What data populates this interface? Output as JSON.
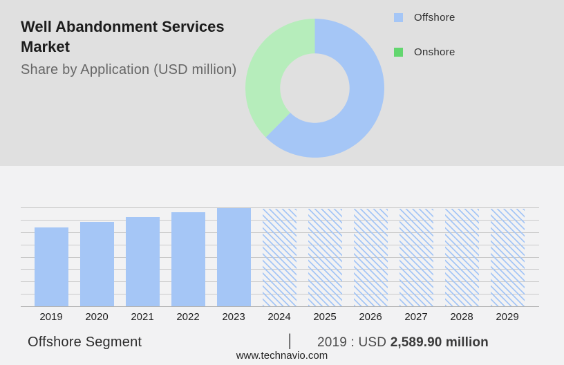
{
  "colors": {
    "top_bg": "#e0e0e0",
    "bottom_bg": "#f2f2f3",
    "bar_blue": "#a5c6f6",
    "donut_green": "#b6edbb",
    "legend_green": "#63d66f",
    "gridline": "#c9c9c9",
    "axis_line": "#b3b3b3",
    "title_text": "#1c1c1c",
    "subtitle_text": "#666666",
    "body_text": "#2e2e2e"
  },
  "header": {
    "title_line1": "Well Abandonment Services",
    "title_line2": "Market",
    "title_full": "Well Abandonment Services Market",
    "subtitle": "Share by Application (USD million)"
  },
  "legend": {
    "items": [
      {
        "label": "Offshore",
        "color_key": "bar_blue"
      },
      {
        "label": "Onshore",
        "color_key": "legend_green"
      }
    ]
  },
  "chart_data": [
    {
      "type": "pie",
      "variant": "donut",
      "title": "Share by Application (USD million)",
      "labels": [
        "Offshore",
        "Onshore"
      ],
      "values_pct": [
        62.5,
        37.5
      ],
      "colors": [
        "#a5c6f6",
        "#b6edbb"
      ],
      "legend_position": "right",
      "start_angle_deg_from_top": 0,
      "direction": "clockwise",
      "inner_radius_ratio": 0.5
    },
    {
      "type": "bar",
      "title": "Offshore Segment market size by year (USD million)",
      "categories": [
        "2019",
        "2020",
        "2021",
        "2022",
        "2023",
        "2024",
        "2025",
        "2026",
        "2027",
        "2028",
        "2029"
      ],
      "values_relative": [
        0.8,
        0.86,
        0.91,
        0.955,
        1.0,
        0.99,
        0.99,
        0.99,
        0.99,
        0.99,
        0.99
      ],
      "bar_styles": [
        "solid",
        "solid",
        "solid",
        "solid",
        "solid",
        "hatched",
        "hatched",
        "hatched",
        "hatched",
        "hatched",
        "hatched"
      ],
      "hatched_bars_meaning": "forecast years",
      "labeled_point": {
        "year": "2019",
        "value": "USD 2,589.90 million"
      },
      "value_2019_usd_million": 2589.9,
      "xlabel": "",
      "ylabel": "",
      "y_axis_labels_shown": false,
      "grid": true,
      "gridline_count": 9
    }
  ],
  "donut": {
    "segments": [
      {
        "name": "Offshore",
        "pct": 62.5,
        "color_key": "bar_blue"
      },
      {
        "name": "Onshore",
        "pct": 37.5,
        "color_key": "donut_green"
      }
    ]
  },
  "footer": {
    "segment_label": "Offshore Segment",
    "separator": "|",
    "value_prefix": "2019 : USD",
    "value_bold": "2,589.90 million",
    "website": "www.technavio.com"
  }
}
